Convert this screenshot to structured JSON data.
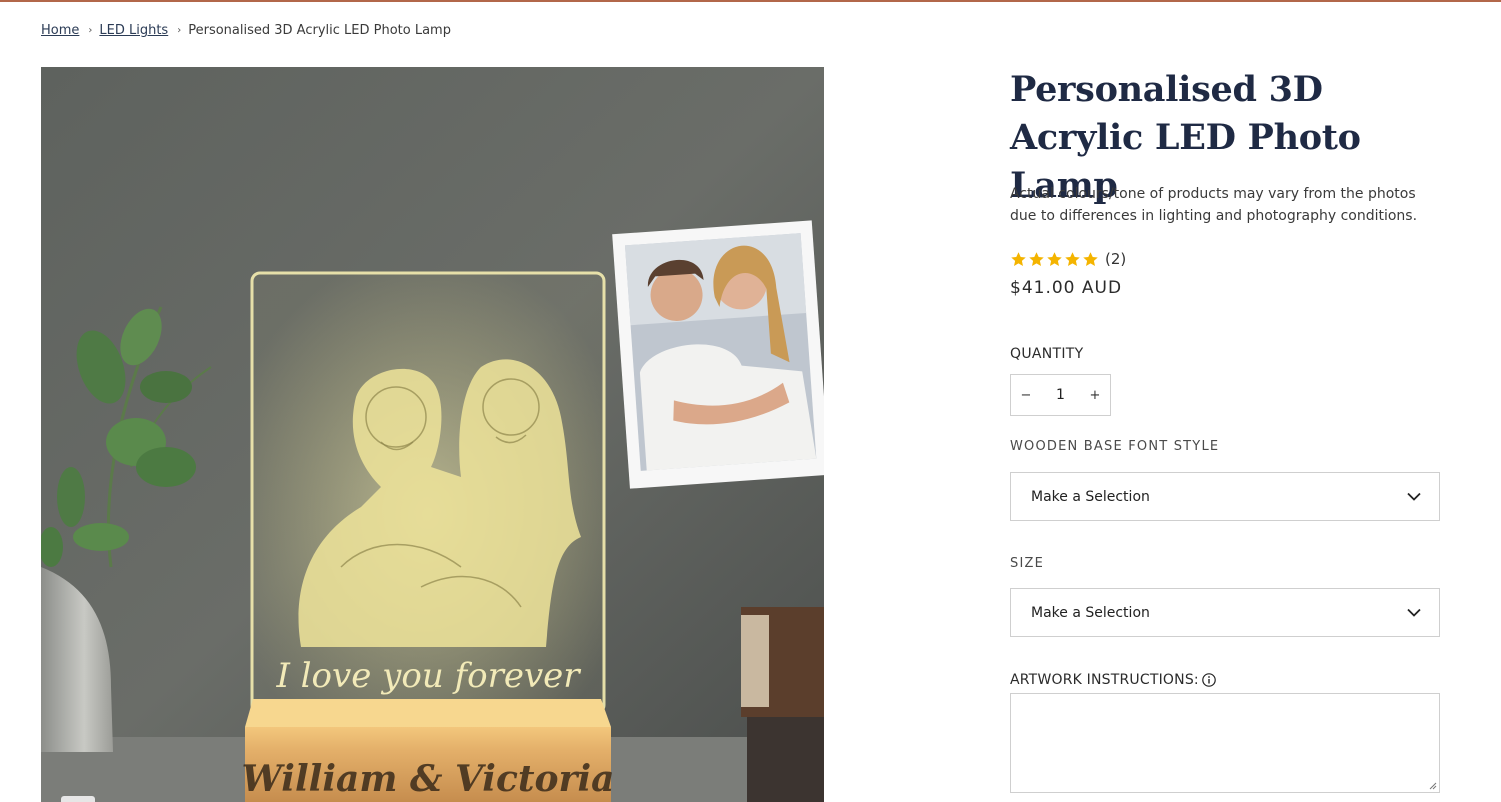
{
  "breadcrumb": {
    "home": "Home",
    "category": "LED Lights",
    "current": "Personalised 3D Acrylic LED Photo Lamp",
    "separator": "›"
  },
  "gallery": {
    "lamp_text": "I love you forever",
    "base_text": "William & Victoria"
  },
  "product": {
    "title": "Personalised 3D Acrylic LED Photo Lamp",
    "disclaimer": "Actual colours/tone of products may vary from the photos due to differences in lighting and photography conditions.",
    "rating": {
      "stars": 5,
      "max": 5,
      "count_label": "(2)",
      "star_color": "#f4b400"
    },
    "price": "$41.00 AUD"
  },
  "quantity": {
    "label": "QUANTITY",
    "value": "1",
    "minus": "−",
    "plus": "+"
  },
  "options": {
    "font_style": {
      "label": "WOODEN BASE FONT STYLE",
      "value": "Make a Selection"
    },
    "size": {
      "label": "SIZE",
      "value": "Make a Selection"
    }
  },
  "artwork": {
    "label": "ARTWORK INSTRUCTIONS:",
    "value": ""
  },
  "colors": {
    "top_rule": "#b2674a",
    "title": "#1f2a44",
    "border": "#cfcfcf"
  }
}
